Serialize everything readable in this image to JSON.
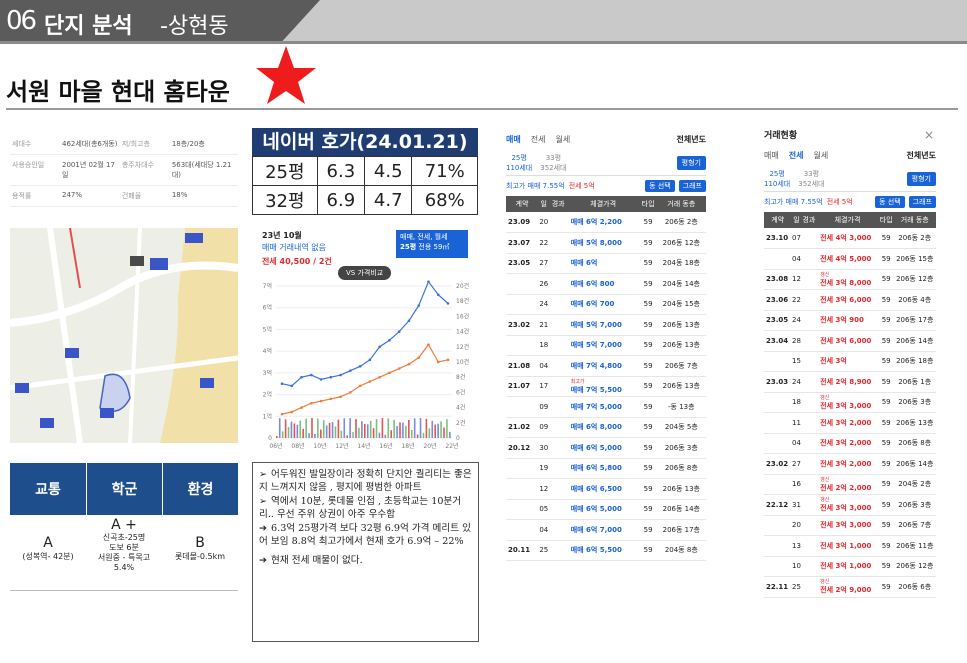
{
  "header": {
    "number": "06",
    "title": "단지 분석",
    "subtitle": "-상현동"
  },
  "page_title": "서원 마을 현대 홈타운",
  "info": {
    "rows": [
      {
        "k1": "세대수",
        "v1": "462세대(총6개동)",
        "k2": "저/최고층",
        "v2": "18층/20층"
      },
      {
        "k1": "사용승인일",
        "v1": "2001년 02월 17일",
        "k2": "총주차대수",
        "v2": "563대(세대당 1.21대)"
      },
      {
        "k1": "용적률",
        "v1": "247%",
        "k2": "건폐율",
        "v2": "18%"
      }
    ]
  },
  "edu": {
    "headers": [
      "교통",
      "학군",
      "환경"
    ],
    "traffic": {
      "grade": "A",
      "note": "(성복역- 42분)"
    },
    "school": {
      "grade": "A +",
      "lines": [
        "신곡초-25명",
        "도보 6분",
        "서원중 - 특목고",
        "5.4%"
      ]
    },
    "env": {
      "grade": "B",
      "note": "롯데몰-0.5km"
    }
  },
  "naver": {
    "title": "네이버 호가(24.01.21)",
    "rows": [
      {
        "size": "25평",
        "sale": "6.3",
        "jeonse": "4.5",
        "ratio": "71%"
      },
      {
        "size": "32평",
        "sale": "6.9",
        "jeonse": "4.7",
        "ratio": "68%"
      }
    ]
  },
  "chart_data": {
    "type": "line",
    "title": "23년 10월",
    "subtitle": "매매 거래내역 없음",
    "jeonse_note": "전세 40,500 / 2건",
    "badge": "VS 가격비교",
    "filter": "매매, 전세, 월세",
    "filter_size": "25평",
    "filter_unit": "전용 59㎡",
    "x": [
      "06년",
      "08년",
      "10년",
      "12년",
      "14년",
      "16년",
      "18년",
      "20년",
      "22년"
    ],
    "left_ticks": [
      "0",
      "1억",
      "2억",
      "3억",
      "4억",
      "5억",
      "6억",
      "7억"
    ],
    "right_ticks": [
      "0",
      "2건",
      "4건",
      "6건",
      "8건",
      "10건",
      "12건",
      "14건",
      "16건",
      "18건",
      "20건"
    ],
    "series": [
      {
        "values": [
          2.5,
          2.4,
          2.8,
          2.9,
          2.7,
          2.8,
          2.9,
          3.1,
          3.3,
          3.6,
          4.2,
          4.5,
          4.9,
          5.4,
          6.1,
          7.2,
          6.6,
          6.2
        ]
      },
      {
        "values": [
          1.1,
          1.2,
          1.4,
          1.6,
          1.7,
          1.8,
          1.9,
          2.1,
          2.4,
          2.6,
          2.8,
          3.0,
          3.2,
          3.4,
          3.7,
          4.3,
          3.5,
          3.6
        ]
      }
    ],
    "colors": {
      "sale": "#3b72d9",
      "jeonse": "#f07a3a"
    }
  },
  "memo": [
    {
      "arrow": "➢",
      "text": "어두워진 발일장이라 정확히 단지안 퀄리티는 좋은지 느껴지지 않음 , 평지에 평범한 아파트"
    },
    {
      "arrow": "➢",
      "text": "역에서 10분, 롯데몰 인접 , 초등학교는 10분거리.. 우선 주위 상권이 아주 우수함"
    },
    {
      "arrow": "➔",
      "text": "6.3억 25평가격 보다 32평 6.9억 가격 메리트 있어 보임 8.8억 최고가에서 현재 호가 6.9억 – 22%"
    },
    {
      "arrow": "➔",
      "text": "현재 전세 매물이 없다."
    }
  ],
  "tx1": {
    "tabs": [
      "매매",
      "전세",
      "월세"
    ],
    "year": "전체년도",
    "size": "25평",
    "house": "110세대",
    "size2": "33평",
    "house2": "352세대",
    "btn": "평형기",
    "high": "최고가 매매 7.55억",
    "high2": "전세 5억",
    "btn2": "동 선택",
    "btn3": "그래프",
    "cols": [
      "계약",
      "일",
      "경과",
      "체결가격",
      "타입",
      "거래 동층"
    ],
    "rows": [
      {
        "d": "23.09",
        "day": "20",
        "p": "매매 6억 2,200",
        "t": "59",
        "f": "206동 2층"
      },
      {
        "d": "23.07",
        "day": "22",
        "p": "매매 5억 8,000",
        "t": "59",
        "f": "206동 12층"
      },
      {
        "d": "23.05",
        "day": "27",
        "p": "매매 6억",
        "t": "59",
        "f": "204동 18층"
      },
      {
        "d": "",
        "day": "26",
        "p": "매매 6억 800",
        "t": "59",
        "f": "204동 14층"
      },
      {
        "d": "",
        "day": "24",
        "p": "매매 6억 700",
        "t": "59",
        "f": "204동 15층"
      },
      {
        "d": "23.02",
        "day": "21",
        "p": "매매 5억 7,000",
        "t": "59",
        "f": "206동 13층"
      },
      {
        "d": "",
        "day": "18",
        "p": "매매 5억 7,000",
        "t": "59",
        "f": "206동 13층"
      },
      {
        "d": "21.08",
        "day": "04",
        "p": "매매 7억 4,800",
        "t": "59",
        "f": "206동 7층"
      },
      {
        "d": "21.07",
        "day": "17",
        "p": "매매 7억 5,500",
        "t": "59",
        "f": "206동 13층",
        "tag": "최고가"
      },
      {
        "d": "",
        "day": "09",
        "p": "매매 7억 5,000",
        "t": "59",
        "f": "-동 13층"
      },
      {
        "d": "21.02",
        "day": "09",
        "p": "매매 6억 8,000",
        "t": "59",
        "f": "204동 5층"
      },
      {
        "d": "20.12",
        "day": "30",
        "p": "매매 6억 5,000",
        "t": "59",
        "f": "206동 3층"
      },
      {
        "d": "",
        "day": "19",
        "p": "매매 6억 5,800",
        "t": "59",
        "f": "206동 8층"
      },
      {
        "d": "",
        "day": "12",
        "p": "매매 6억 6,500",
        "t": "59",
        "f": "206동 13층"
      },
      {
        "d": "",
        "day": "05",
        "p": "매매 6억 5,000",
        "t": "59",
        "f": "206동 14층"
      },
      {
        "d": "",
        "day": "04",
        "p": "매매 6억 7,000",
        "t": "59",
        "f": "206동 17층"
      },
      {
        "d": "20.11",
        "day": "25",
        "p": "매매 6억 5,500",
        "t": "59",
        "f": "204동 8층"
      }
    ]
  },
  "tx2": {
    "title": "거래현황",
    "tabs": [
      "매매",
      "전세",
      "월세"
    ],
    "year": "전체년도",
    "size": "25평",
    "house": "110세대",
    "size2": "33평",
    "house2": "352세대",
    "btn": "평형기",
    "high": "최고가 매매 7.55억",
    "high2": "전세 5억",
    "btn2": "동 선택",
    "btn3": "그래프",
    "cols": [
      "계약",
      "일",
      "경과",
      "체결가격",
      "타입",
      "거래 동층"
    ],
    "rows": [
      {
        "d": "23.10",
        "day": "07",
        "p": "전세 4억 3,000",
        "t": "59",
        "f": "206동 2층"
      },
      {
        "d": "",
        "day": "04",
        "p": "전세 4억 5,000",
        "t": "59",
        "f": "206동 15층"
      },
      {
        "d": "23.08",
        "day": "12",
        "p": "전세 3억 8,000",
        "t": "59",
        "f": "206동 12층",
        "tag": "갱신"
      },
      {
        "d": "23.06",
        "day": "22",
        "p": "전세 3억 6,000",
        "t": "59",
        "f": "206동 4층"
      },
      {
        "d": "23.05",
        "day": "24",
        "p": "전세 3억 900",
        "t": "59",
        "f": "206동 17층"
      },
      {
        "d": "23.04",
        "day": "28",
        "p": "전세 3억 6,000",
        "t": "59",
        "f": "206동 14층"
      },
      {
        "d": "",
        "day": "15",
        "p": "전세 3억",
        "t": "59",
        "f": "206동 18층"
      },
      {
        "d": "23.03",
        "day": "24",
        "p": "전세 2억 8,900",
        "t": "59",
        "f": "206동 1층"
      },
      {
        "d": "",
        "day": "18",
        "p": "전세 3억 3,000",
        "t": "59",
        "f": "206동 3층",
        "tag": "갱신"
      },
      {
        "d": "",
        "day": "11",
        "p": "전세 3억 2,000",
        "t": "59",
        "f": "206동 13층"
      },
      {
        "d": "",
        "day": "04",
        "p": "전세 3억 2,000",
        "t": "59",
        "f": "206동 8층"
      },
      {
        "d": "23.02",
        "day": "27",
        "p": "전세 3억 2,000",
        "t": "59",
        "f": "206동 14층"
      },
      {
        "d": "",
        "day": "16",
        "p": "전세 2억 2,000",
        "t": "59",
        "f": "204동 2층",
        "tag": "갱신"
      },
      {
        "d": "22.12",
        "day": "31",
        "p": "전세 3억 3,000",
        "t": "59",
        "f": "206동 3층",
        "tag": "갱신"
      },
      {
        "d": "",
        "day": "20",
        "p": "전세 3억 3,000",
        "t": "59",
        "f": "206동 7층"
      },
      {
        "d": "",
        "day": "13",
        "p": "전세 3억 1,000",
        "t": "59",
        "f": "206동 11층"
      },
      {
        "d": "",
        "day": "10",
        "p": "전세 3억 1,000",
        "t": "59",
        "f": "206동 12층"
      },
      {
        "d": "22.11",
        "day": "25",
        "p": "전세 2억 9,000",
        "t": "59",
        "f": "206동 6층",
        "tag": "갱신"
      }
    ]
  }
}
